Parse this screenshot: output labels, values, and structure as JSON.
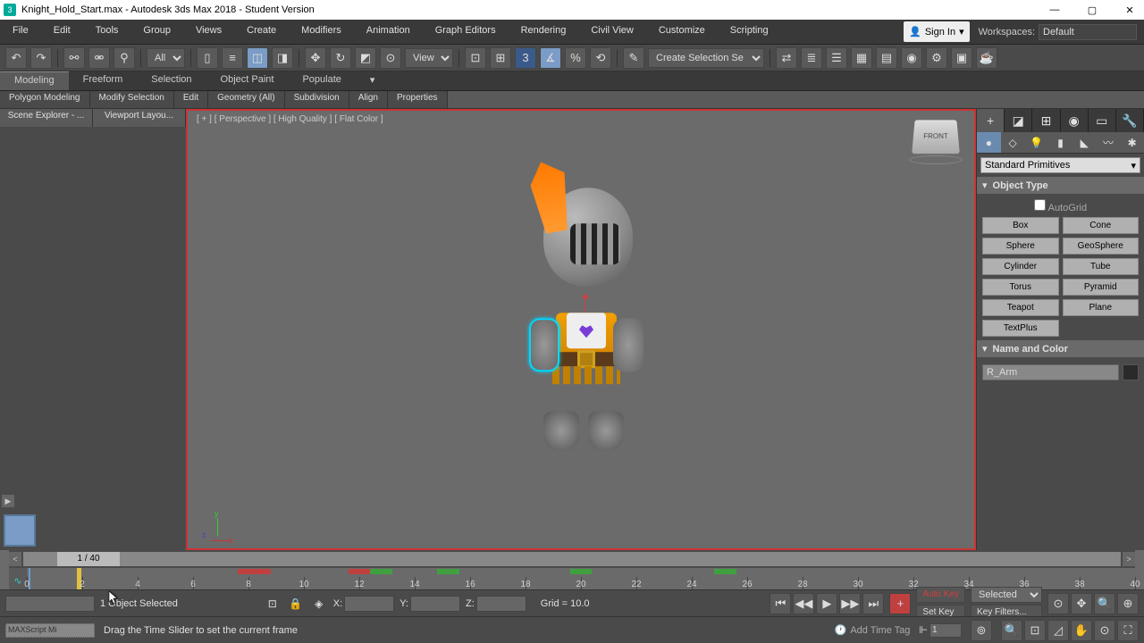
{
  "title": "Knight_Hold_Start.max - Autodesk 3ds Max 2018 - Student Version",
  "menus": [
    "File",
    "Edit",
    "Tools",
    "Group",
    "Views",
    "Create",
    "Modifiers",
    "Animation",
    "Graph Editors",
    "Rendering",
    "Civil View",
    "Customize",
    "Scripting"
  ],
  "signin": "Sign In",
  "workspaces_lbl": "Workspaces:",
  "workspace": "Default",
  "all_filter": "All",
  "view_btn": "View",
  "sel_set": "Create Selection Se",
  "ribbon": [
    "Modeling",
    "Freeform",
    "Selection",
    "Object Paint",
    "Populate"
  ],
  "subribbon": [
    "Polygon Modeling",
    "Modify Selection",
    "Edit",
    "Geometry (All)",
    "Subdivision",
    "Align",
    "Properties"
  ],
  "left_tabs": [
    "Scene Explorer - ...",
    "Viewport Layou..."
  ],
  "vp_label": "[ + ] [ Perspective ] [ High Quality ] [ Flat Color ]",
  "viewcube": "FRONT",
  "cmd_dropdown": "Standard Primitives",
  "roll1": "Object Type",
  "autogrid": "AutoGrid",
  "prim": [
    "Box",
    "Cone",
    "Sphere",
    "GeoSphere",
    "Cylinder",
    "Tube",
    "Torus",
    "Pyramid",
    "Teapot",
    "Plane",
    "TextPlus"
  ],
  "roll2": "Name and Color",
  "obj_name": "R_Arm",
  "frame": "1 / 40",
  "sel_count": "1 Object Selected",
  "hint": "Drag the Time Slider to set the current frame",
  "coords": {
    "x": "X:",
    "y": "Y:",
    "z": "Z:",
    "grid": "Grid = 10.0"
  },
  "autokey": "Auto Key",
  "setkey": "Set Key",
  "selected_dd": "Selected",
  "keyfilters": "Key Filters...",
  "timetag": "Add Time Tag",
  "spinval": "1",
  "maxscript": "MAXScript Mi",
  "timeline_labels": [
    0,
    2,
    4,
    6,
    8,
    10,
    12,
    14,
    16,
    18,
    20,
    22,
    24,
    26,
    28,
    30,
    32,
    34,
    36,
    38,
    40
  ]
}
